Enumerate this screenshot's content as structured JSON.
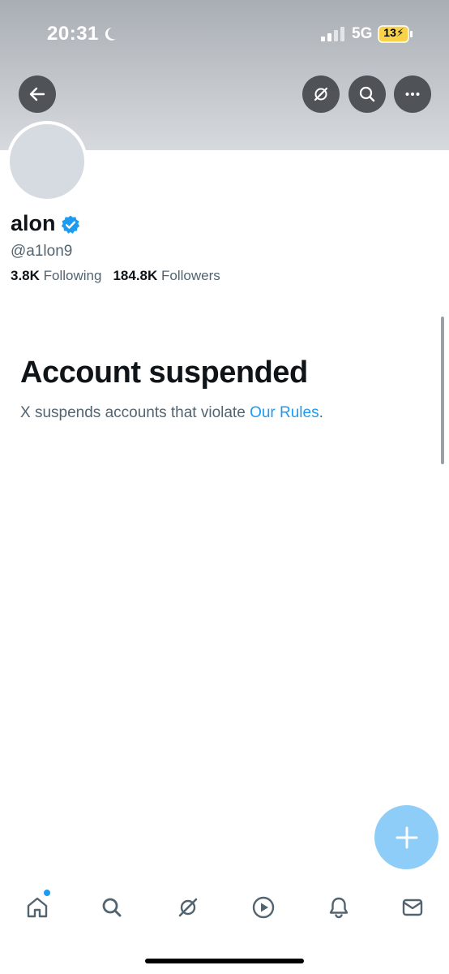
{
  "status_bar": {
    "time": "20:31",
    "network": "5G",
    "battery": "13",
    "icons": [
      "moon-icon",
      "signal-icon",
      "battery-icon"
    ]
  },
  "header": {
    "buttons": [
      "back-arrow-icon",
      "grok-icon",
      "search-icon",
      "more-icon"
    ]
  },
  "profile": {
    "name": "alon",
    "handle": "@a1lon9",
    "following_count": "3.8K",
    "following_label": "Following",
    "followers_count": "184.8K",
    "followers_label": "Followers",
    "verified": true
  },
  "suspended": {
    "title": "Account suspended",
    "message": "X suspends accounts that violate ",
    "link": "Our Rules",
    "end": "."
  },
  "fab": {
    "icon": "plus-icon"
  },
  "tab_bar": {
    "items": [
      "home-icon",
      "search-icon",
      "grok-icon",
      "video-icon",
      "notifications-icon",
      "messages-icon"
    ]
  },
  "colors": {
    "accent": "#1d9bf0",
    "fab": "#8ecdf8",
    "text": "#0f1419",
    "muted": "#536471"
  }
}
